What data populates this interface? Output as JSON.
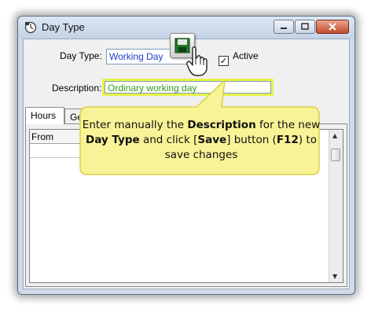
{
  "window": {
    "title": "Day Type",
    "min_icon": "minimize-icon",
    "max_icon": "maximize-icon",
    "close_icon": "close-icon"
  },
  "form": {
    "day_type_label": "Day Type:",
    "day_type_value": "Working Day",
    "active_label": "Active",
    "active_checked": true,
    "description_label": "Description:",
    "description_value": "Ordinary working day"
  },
  "tabs": [
    {
      "label": "Hours"
    },
    {
      "label": "Ge"
    }
  ],
  "grid": {
    "columns": [
      "From"
    ]
  },
  "toolbar": {
    "save_icon": "save-icon"
  },
  "callout": {
    "text_parts": [
      {
        "text": "Enter manually the ",
        "bold": false
      },
      {
        "text": "Description",
        "bold": true
      },
      {
        "text": " for the new ",
        "bold": false
      },
      {
        "text": "Day Type",
        "bold": true
      },
      {
        "text": " and click [",
        "bold": false
      },
      {
        "text": "Save",
        "bold": true
      },
      {
        "text": "] button (",
        "bold": false
      },
      {
        "text": "F12",
        "bold": true
      },
      {
        "text": ") to save changes",
        "bold": false
      }
    ],
    "fill": "#f8f396",
    "stroke": "#d9d04a"
  },
  "colors": {
    "highlight": "#e8f24a",
    "description_text": "#2e9a20",
    "day_type_text": "#1b3cc9"
  }
}
